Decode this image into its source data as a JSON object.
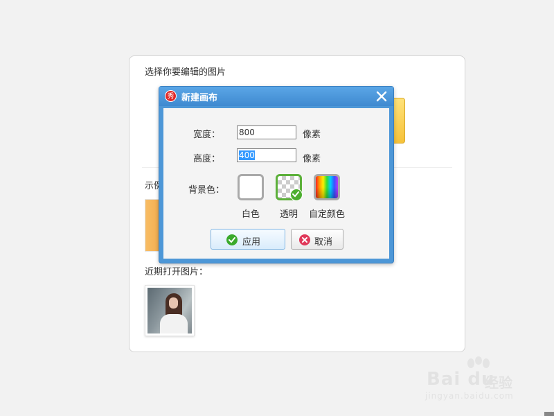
{
  "panel": {
    "title": "选择你要编辑的图片",
    "example_label": "示例",
    "recent_label": "近期打开图片："
  },
  "dialog": {
    "title": "新建画布",
    "app_icon_text": "秀",
    "width_label": "宽度：",
    "width_value": "800",
    "height_label": "高度：",
    "height_value": "400",
    "unit": "像素",
    "bg_label": "背景色：",
    "bg_options": [
      {
        "label": "白色",
        "icon": "white-swatch"
      },
      {
        "label": "透明",
        "icon": "transparent-swatch",
        "selected": true
      },
      {
        "label": "自定颜色",
        "icon": "rainbow-swatch"
      }
    ],
    "apply_label": "应用",
    "cancel_label": "取消"
  },
  "watermark": {
    "brand": "Bai du",
    "suffix": "经验",
    "url": "jingyan.baidu.com"
  },
  "colors": {
    "titlebar": "#4d97d7",
    "selected_border": "#5cb03a",
    "cancel_icon": "#e0395a"
  }
}
